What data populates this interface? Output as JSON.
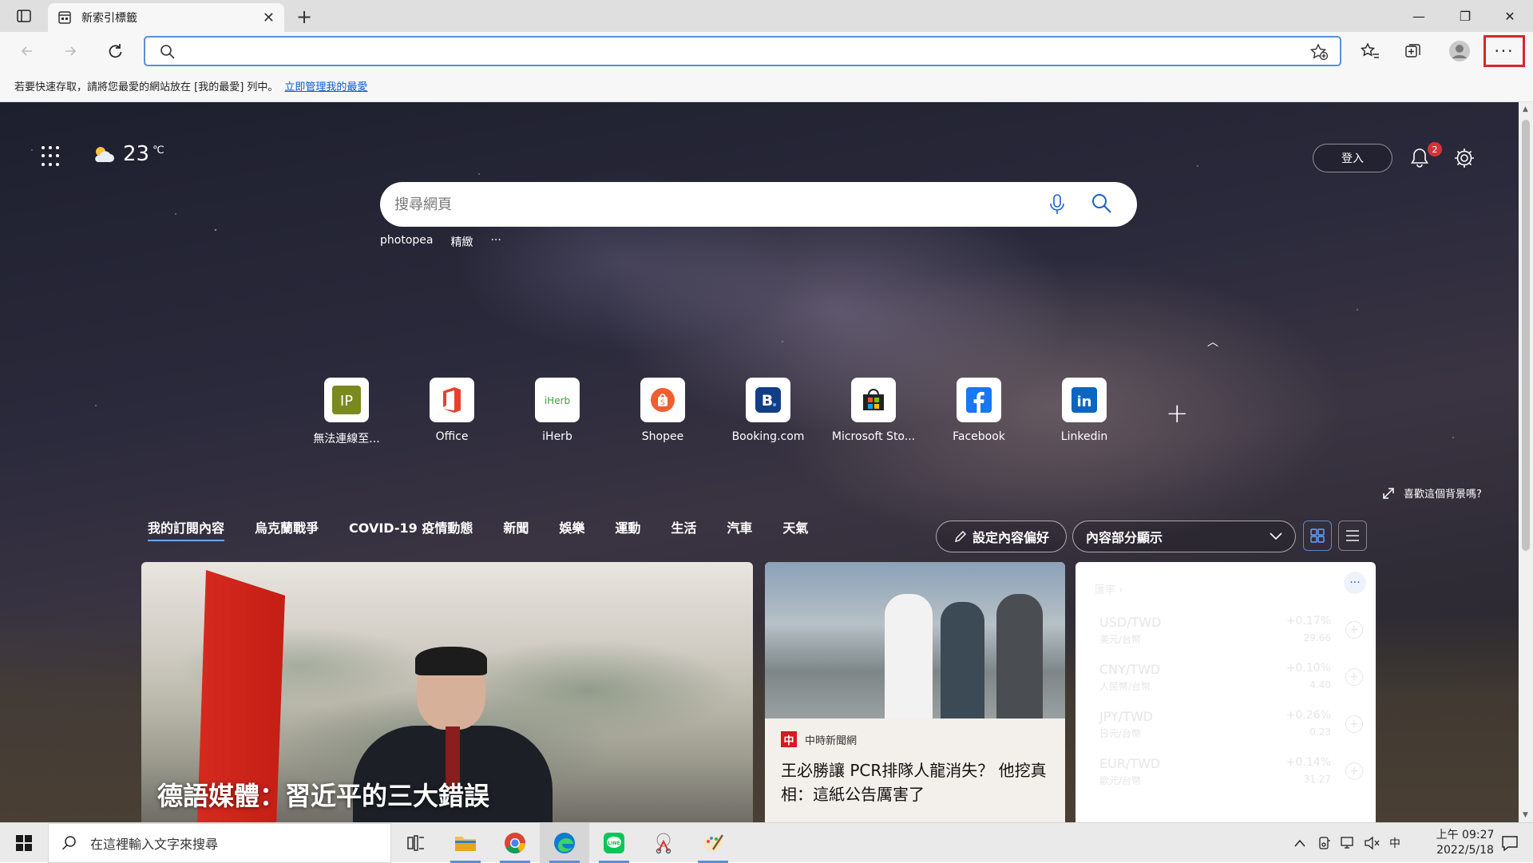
{
  "browser": {
    "tab_title": "新索引標籤",
    "tab_close": "✕",
    "new_tab": "+",
    "window_controls": {
      "minimize": "—",
      "restore": "❐",
      "close": "✕"
    },
    "address_value": "",
    "more_label": "···"
  },
  "favbar": {
    "text": "若要快速存取，請將您最愛的網站放在 [我的最愛] 列中。",
    "link": "立即管理我的最愛"
  },
  "ntp": {
    "weather": {
      "temp": "23",
      "unit": "℃"
    },
    "signin": "登入",
    "notification_count": "2",
    "search_placeholder": "搜尋網頁",
    "quick_links": [
      "photopea",
      "精緻",
      "···"
    ],
    "collapse": "︿",
    "tiles": [
      {
        "label": "無法連線至...",
        "icon": "ip-icon"
      },
      {
        "label": "Office",
        "icon": "office-icon"
      },
      {
        "label": "iHerb",
        "icon": "iherb-icon"
      },
      {
        "label": "Shopee",
        "icon": "shopee-icon"
      },
      {
        "label": "Booking.com",
        "icon": "booking-icon"
      },
      {
        "label": "Microsoft Sto...",
        "icon": "microsoft-store-icon"
      },
      {
        "label": "Facebook",
        "icon": "facebook-icon"
      },
      {
        "label": "Linkedin",
        "icon": "linkedin-icon"
      }
    ],
    "tile_add": "+",
    "like_background": "喜歡這個背景嗎?",
    "feed_tabs": [
      "我的訂閱內容",
      "烏克蘭戰爭",
      "COVID-19 疫情動態",
      "新聞",
      "娛樂",
      "運動",
      "生活",
      "汽車",
      "天氣"
    ],
    "preferences_button": "設定內容偏好",
    "display_select": "內容部分顯示"
  },
  "cards": {
    "hero_title": "德語媒體：習近平的三大錯誤",
    "news_source": "中時新聞網",
    "news_source_logo": "中",
    "news_title": "王必勝讓 PCR排隊人龍消失？ 他挖真相：這紙公告厲害了",
    "fx": {
      "header": "匯率 ›",
      "more": "···",
      "rows": [
        {
          "pair": "USD/TWD",
          "sub": "美元/台幣",
          "change": "+0.17%",
          "value": "29.66"
        },
        {
          "pair": "CNY/TWD",
          "sub": "人民幣/台幣",
          "change": "+0.10%",
          "value": "4.40"
        },
        {
          "pair": "JPY/TWD",
          "sub": "日元/台幣",
          "change": "+0.26%",
          "value": "0.23"
        },
        {
          "pair": "EUR/TWD",
          "sub": "歐元/台幣",
          "change": "+0.14%",
          "value": "31.27"
        }
      ]
    }
  },
  "taskbar": {
    "search_placeholder": "在這裡輸入文字來搜尋",
    "ime": "中",
    "time": "上午 09:27",
    "date": "2022/5/18"
  }
}
